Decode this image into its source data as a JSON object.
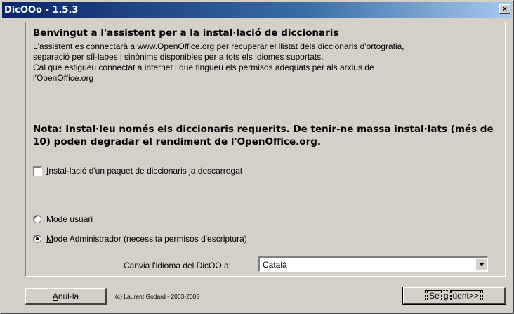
{
  "window": {
    "title": "DicOOo - 1.5.3",
    "close_label": "×"
  },
  "heading": "Benvingut a l'assistent per a la instal·lació de diccionaris",
  "description": [
    "L'assistent es connectarà a www.OpenOffice.org per recuperar el llistat dels diccionaris d'ortografia,",
    "separació per síl·labes i sinònims disponibles per a tots els idiomes suportats.",
    "Cal que estigueu connectat a internet i que tingueu els permisos adequats per als arxius de",
    "l'OpenOffice.org"
  ],
  "note": [
    "Nota: Instal·leu només els diccionaris requerits. De tenir-ne massa instal·lats (més de",
    "10) poden degradar el rendiment de l'OpenOffice.org."
  ],
  "checkbox": {
    "label_u": "I",
    "label_rest": "nstal·lació d'un paquet de diccionaris ja descarregat",
    "checked": false
  },
  "radio_user": {
    "pre": "Mo",
    "u": "d",
    "post": "e usuari",
    "checked": false
  },
  "radio_admin": {
    "pre": "",
    "u": "M",
    "post": "ode Administrador (necessita permisos d'escriptura)",
    "checked": true
  },
  "language": {
    "label": "Canvia l'idioma del DicOO a:",
    "value": "Català"
  },
  "buttons": {
    "cancel_u": "A",
    "cancel_rest": "nul·la",
    "next_pre": "Se",
    "next_u": "g",
    "next_post": "üent>>"
  },
  "copyright": "(c) Laurent Godard - 2003-2005"
}
